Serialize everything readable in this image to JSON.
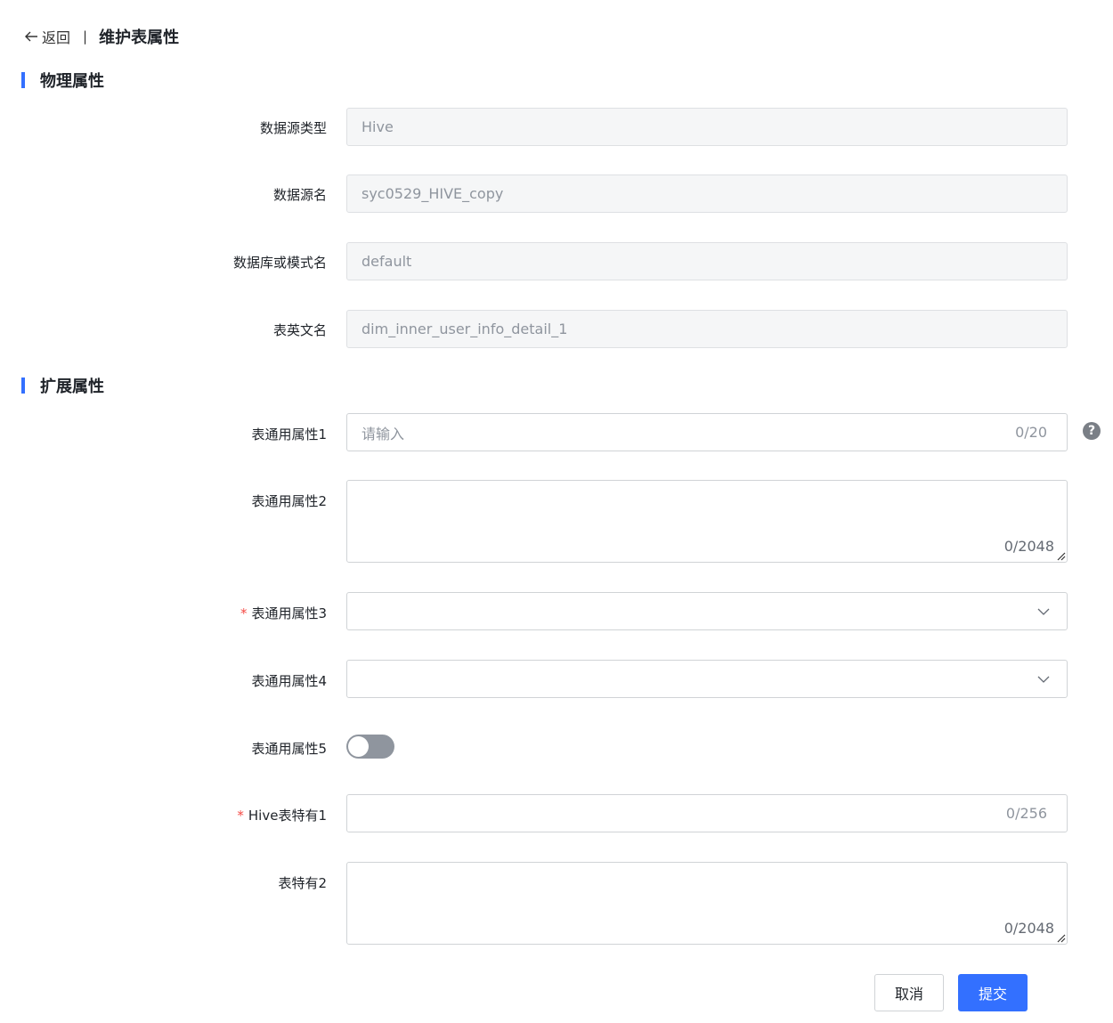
{
  "header": {
    "back_label": "返回",
    "separator": "|",
    "title": "维护表属性"
  },
  "sections": {
    "physical": "物理属性",
    "extended": "扩展属性"
  },
  "physical_fields": {
    "datasource_type": {
      "label": "数据源类型",
      "value": "Hive"
    },
    "datasource_name": {
      "label": "数据源名",
      "value": "syc0529_HIVE_copy"
    },
    "database_name": {
      "label": "数据库或模式名",
      "value": "default"
    },
    "table_name": {
      "label": "表英文名",
      "value": "dim_inner_user_info_detail_1"
    }
  },
  "extended_fields": {
    "attr1": {
      "label": "表通用属性1",
      "placeholder": "请输入",
      "value": "",
      "counter": "0/20"
    },
    "attr2": {
      "label": "表通用属性2",
      "value": "",
      "counter": "0/2048"
    },
    "attr3": {
      "label": "表通用属性3",
      "required_mark": "*",
      "value": ""
    },
    "attr4": {
      "label": "表通用属性4",
      "value": ""
    },
    "attr5": {
      "label": "表通用属性5",
      "enabled": false
    },
    "hive1": {
      "label": "Hive表特有1",
      "required_mark": "*",
      "value": "",
      "counter": "0/256"
    },
    "special2": {
      "label": "表特有2",
      "value": "",
      "counter": "0/2048"
    }
  },
  "help_icon": "?",
  "buttons": {
    "cancel": "取消",
    "submit": "提交"
  },
  "colors": {
    "accent": "#3370ff",
    "required": "#f54a45",
    "disabled_bg": "#f5f6f7"
  }
}
